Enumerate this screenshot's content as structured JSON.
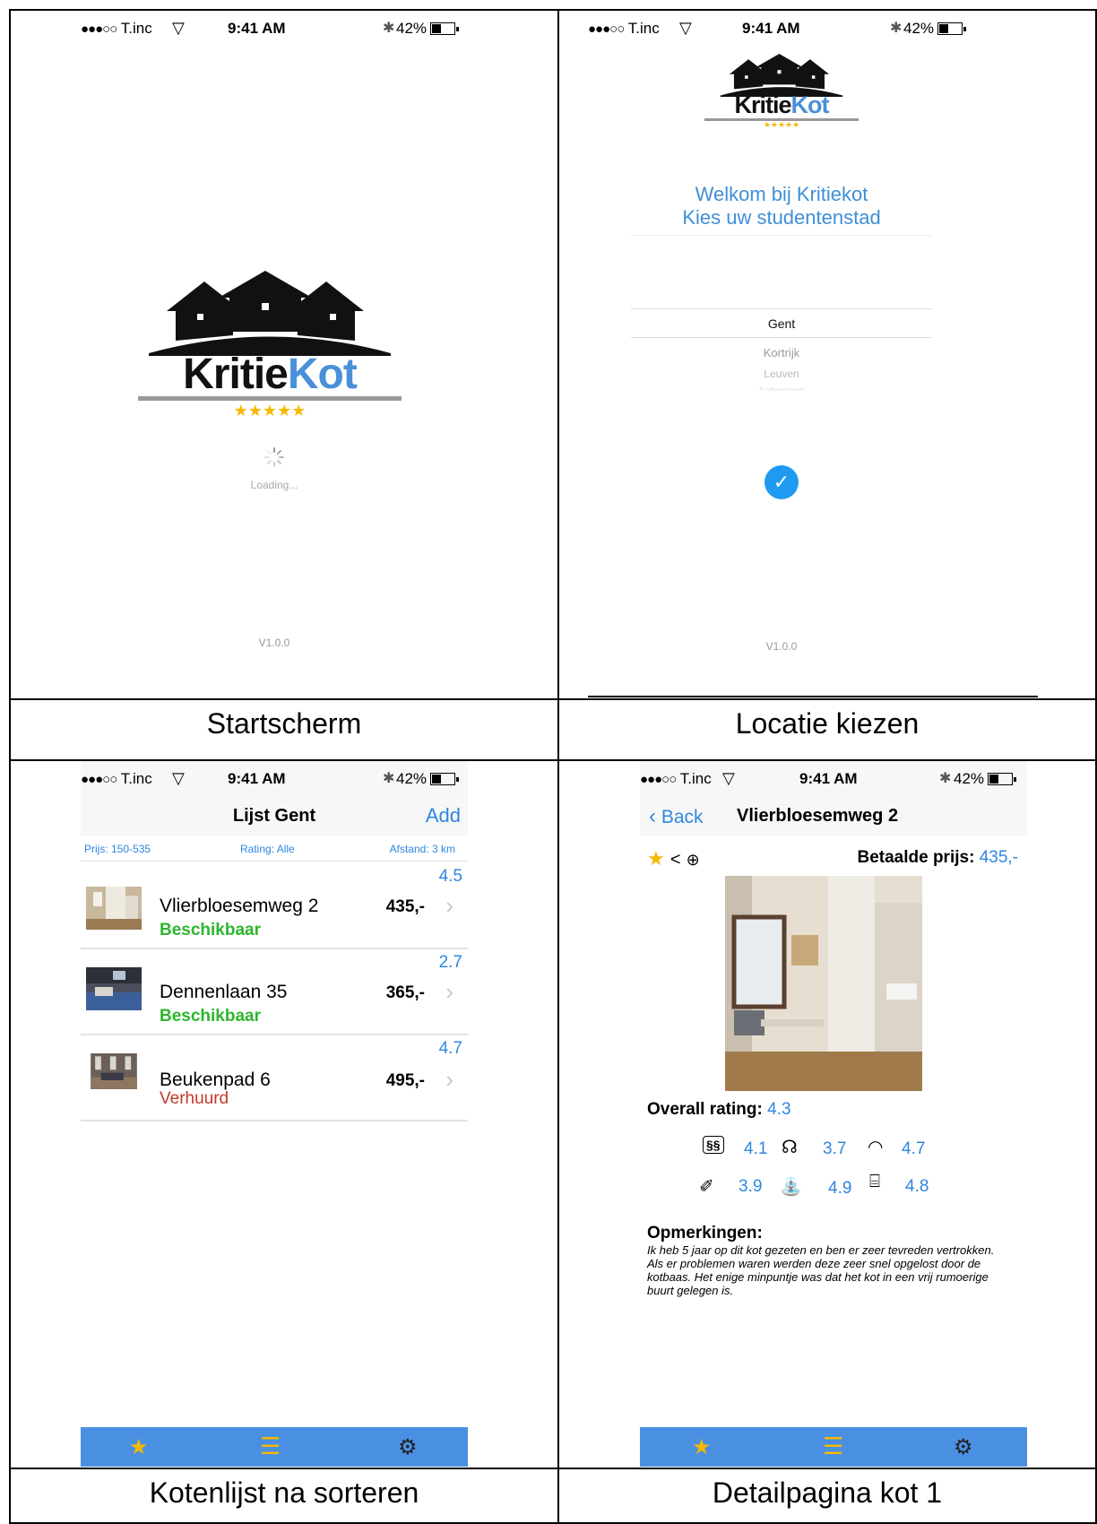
{
  "status_bar": {
    "carrier": "T.inc",
    "time": "9:41 AM",
    "battery": "42%",
    "battery_level": 0.42
  },
  "logo": {
    "part1": "Kritie",
    "part2": "Kot",
    "stars": "★★★★★"
  },
  "captions": {
    "s1": "Startscherm",
    "s2": "Locatie kiezen",
    "s3": "Kotenlijst na sorteren",
    "s4": "Detailpagina kot 1"
  },
  "startscreen": {
    "loading": "Loading...",
    "version": "V1.0.0"
  },
  "location": {
    "welcome_line1": "Welkom bij Kritiekot",
    "welcome_line2": "Kies uw studentenstad",
    "cities": [
      "Gent",
      "Kortrijk",
      "Leuven",
      "Antwerpen"
    ],
    "selected": "Gent",
    "version": "V1.0.0"
  },
  "list": {
    "title": "Lijst Gent",
    "add": "Add",
    "filter_price": "Prijs: 150-535",
    "filter_rating": "Rating: Alle",
    "filter_distance": "Afstand: 3 km",
    "items": [
      {
        "name": "Vlierbloesemweg 2",
        "status": "Beschikbaar",
        "price": "435,-",
        "rating": "4.5"
      },
      {
        "name": "Dennenlaan 35",
        "status": "Beschikbaar",
        "price": "365,-",
        "rating": "2.7"
      },
      {
        "name": "Beukenpad 6",
        "status": "Verhuurd",
        "price": "495,-",
        "rating": "4.7"
      }
    ]
  },
  "detail": {
    "back": "Back",
    "title": "Vlierbloesemweg 2",
    "paid_label": "Betaalde prijs:",
    "paid_value": "435,-",
    "overall_label": "Overall rating:",
    "overall_value": "4.3",
    "ratings": {
      "heating": "4.1",
      "noise": "3.7",
      "wifi": "4.7",
      "cleaning": "3.9",
      "sanitary": "4.9",
      "kitchen": "4.8"
    },
    "remarks_label": "Opmerkingen:",
    "remarks": "Ik heb 5 jaar op dit kot gezeten en ben er zeer tevreden vertrokken. Als er problemen waren werden deze zeer snel opgelost door de kotbaas. Het enige minpuntje was dat het kot in een vrij rumoerige buurt gelegen is."
  },
  "colors": {
    "accent": "#2f86e0",
    "available": "#2db52d",
    "rented": "#c0392b",
    "tabbar": "#4a90e2",
    "star": "#f5b800"
  },
  "icons": {
    "tab_favorites": "star-icon",
    "tab_list": "list-icon",
    "tab_settings": "gear-icon"
  }
}
